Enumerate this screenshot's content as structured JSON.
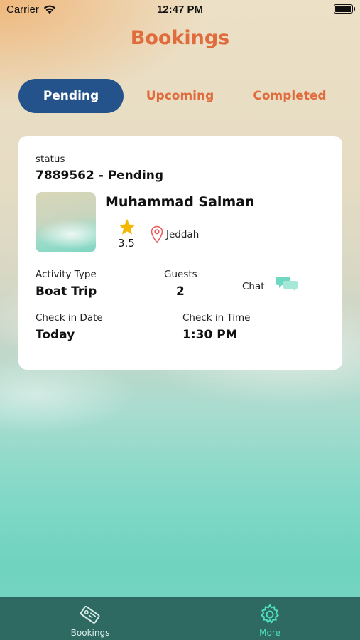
{
  "status_bar": {
    "carrier": "Carrier",
    "time": "12:47 PM"
  },
  "header": {
    "title": "Bookings"
  },
  "tabs": [
    {
      "label": "Pending",
      "active": true
    },
    {
      "label": "Upcoming",
      "active": false
    },
    {
      "label": "Completed",
      "active": false
    }
  ],
  "booking": {
    "status_label": "status",
    "id_status": "7889562 - Pending",
    "name": "Muhammad Salman",
    "rating": "3.5",
    "city": "Jeddah",
    "activity_type_label": "Activity Type",
    "activity_type": "Boat Trip",
    "guests_label": "Guests",
    "guests": "2",
    "chat_label": "Chat",
    "checkin_date_label": "Check in Date",
    "checkin_date": "Today",
    "checkin_time_label": "Check in Time",
    "checkin_time": "1:30 PM"
  },
  "tabbar": {
    "items": [
      {
        "label": "Bookings",
        "icon": "ticket-icon",
        "color": "#d9ecea"
      },
      {
        "label": "More",
        "icon": "gear-icon",
        "color": "#4fe0c0"
      }
    ]
  },
  "colors": {
    "accent": "#e06b3d",
    "active_tab": "#24528a",
    "tabbar_bg": "#2e6a62",
    "star": "#f5b800",
    "chat": "#6fd8c2"
  }
}
